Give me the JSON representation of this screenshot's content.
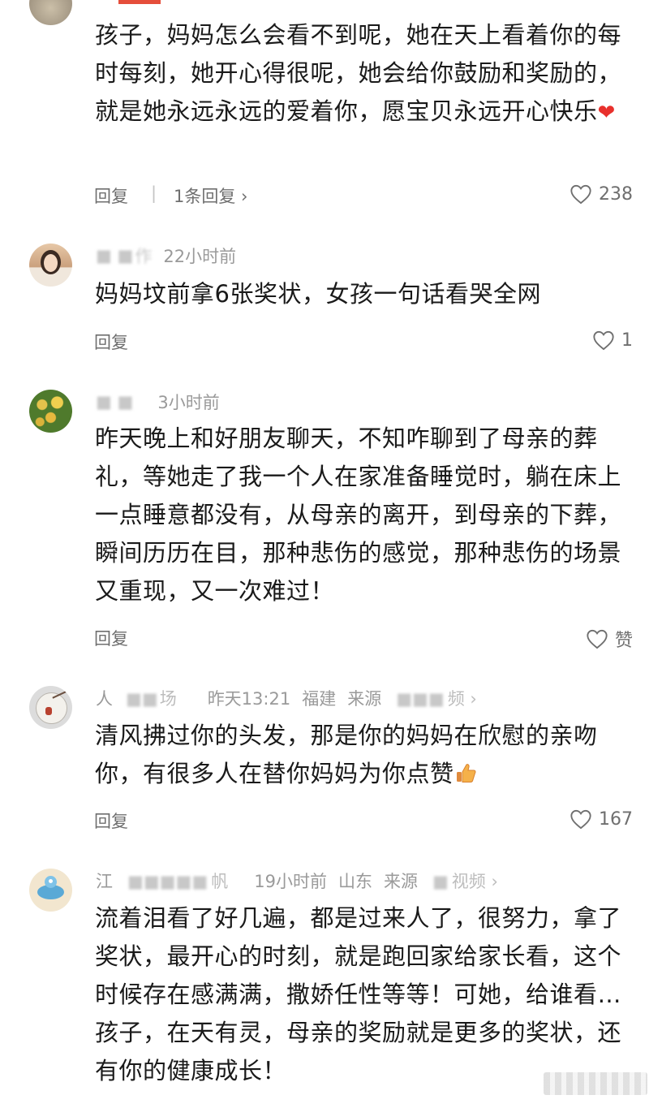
{
  "comments": [
    {
      "body": "孩子，妈妈怎么会看不到呢，她在天上看着你的每时每刻，她开心得很呢，她会给你鼓励和奖励的，就是她永远永远的爱着你，愿宝贝永远开心快乐",
      "reply_label": "回复",
      "replies_label": "1条回复 ›",
      "likes": "238"
    },
    {
      "name": "作",
      "time": "22小时前",
      "body": "妈妈坟前拿6张奖状，女孩一句话看哭全网",
      "reply_label": "回复",
      "likes": "1"
    },
    {
      "time": "3小时前",
      "body": "昨天晚上和好朋友聊天，不知咋聊到了母亲的葬礼，等她走了我一个人在家准备睡觉时，躺在床上一点睡意都没有，从母亲的离开，到母亲的下葬，瞬间历历在目，那种悲伤的感觉，那种悲伤的场景又重现，又一次难过！",
      "reply_label": "回复",
      "likes": "赞"
    },
    {
      "name": "人",
      "name_tail": "场",
      "time": "昨天13:21",
      "location": "福建",
      "source": "来源",
      "source_tail": "频 ›",
      "body": "清风拂过你的头发，那是你的妈妈在欣慰的亲吻你，有很多人在替你妈妈为你点赞",
      "reply_label": "回复",
      "likes": "167"
    },
    {
      "name": "江",
      "name_tail": "帆",
      "time": "19小时前",
      "location": "山东",
      "source": "来源",
      "source_tail": "视频 ›",
      "body": "流着泪看了好几遍，都是过来人了，很努力，拿了奖状，最开心的时刻，就是跑回家给家长看，这个时候存在感满满，撒娇任性等等！可她，给谁看…孩子，在天有灵，母亲的奖励就是更多的奖状，还有你的健康成长！"
    }
  ],
  "colors": {
    "accent": "#e54e3b",
    "text": "#1a1a1a",
    "meta": "#9a9a9a",
    "action": "#6f6f6f"
  },
  "icons": {
    "like": "heart-outline-icon",
    "emoji_heart": "red-heart-emoji",
    "emoji_thumb": "thumbs-up-emoji"
  }
}
